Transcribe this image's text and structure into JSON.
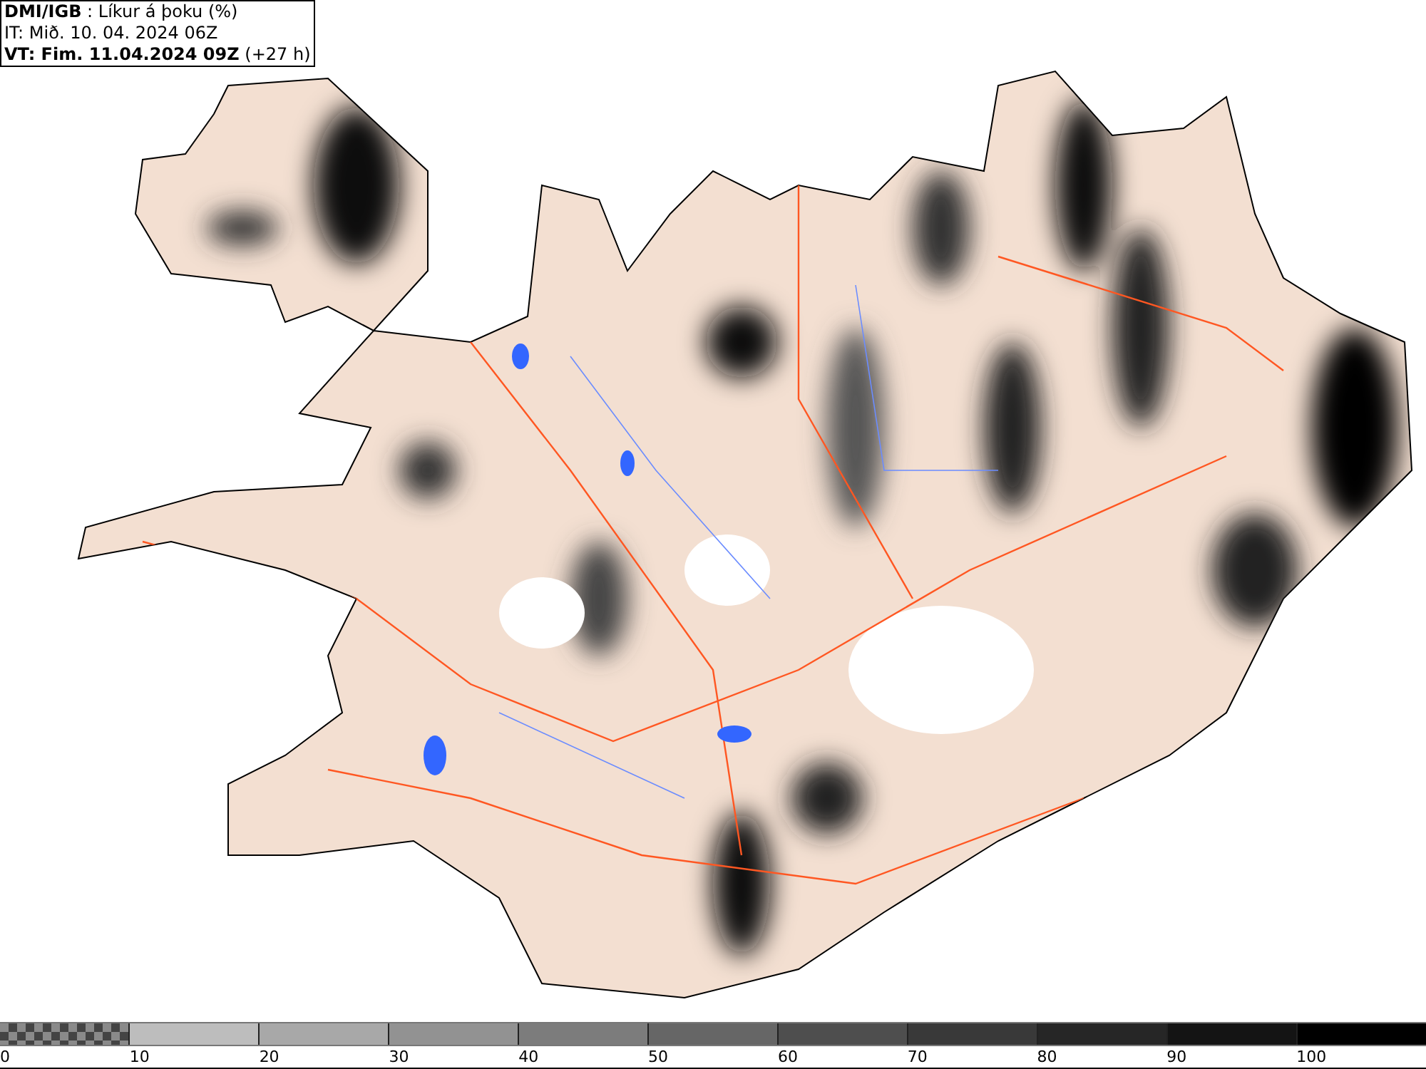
{
  "header": {
    "lines": [
      "**DMI/IGB** : Líkur á þoku (%)",
      "IT: Mið. 10. 04. 2024 06Z",
      "**VT: Fim. 11.04.2024 09Z** (+27 h)"
    ]
  },
  "legend": {
    "segments": [
      {
        "kind": "checkered",
        "color": "#8a8a8a"
      },
      {
        "kind": "solid",
        "color": "#bdbdbd"
      },
      {
        "kind": "solid",
        "color": "#a8a8a8"
      },
      {
        "kind": "solid",
        "color": "#929292"
      },
      {
        "kind": "solid",
        "color": "#7c7c7c"
      },
      {
        "kind": "solid",
        "color": "#666666"
      },
      {
        "kind": "solid",
        "color": "#4e4e4e"
      },
      {
        "kind": "solid",
        "color": "#393939"
      },
      {
        "kind": "solid",
        "color": "#262626"
      },
      {
        "kind": "solid",
        "color": "#141414"
      },
      {
        "kind": "solid",
        "color": "#000000"
      }
    ],
    "labels": [
      "0",
      "10",
      "20",
      "30",
      "40",
      "50",
      "60",
      "70",
      "80",
      "90",
      "100"
    ]
  }
}
